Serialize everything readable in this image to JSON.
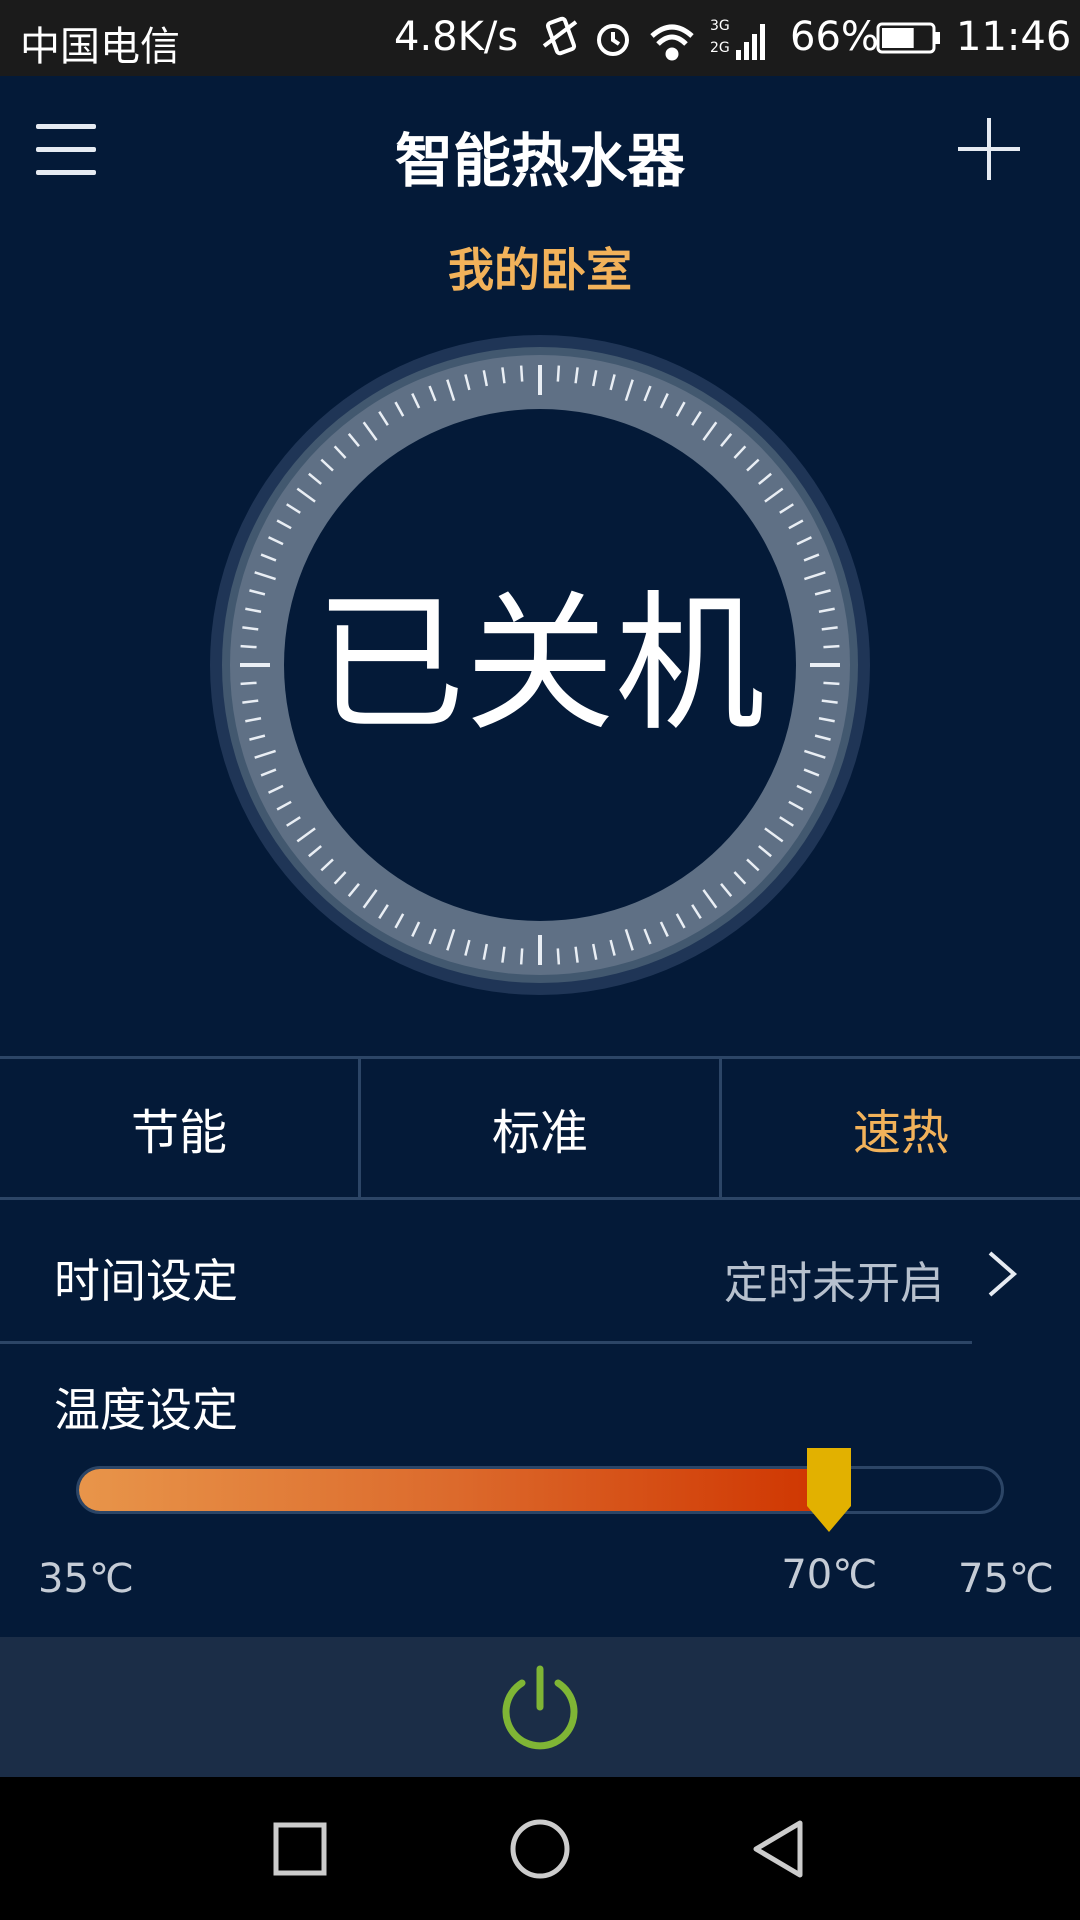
{
  "status_bar": {
    "carrier": "中国电信",
    "network_speed": "4.8K/s",
    "network_type_top": "3G",
    "network_type_bottom": "2G",
    "battery": "66%",
    "battery_level": 0.66,
    "time": "11:46"
  },
  "header": {
    "title": "智能热水器",
    "room": "我的卧室"
  },
  "dial": {
    "status": "已关机"
  },
  "modes": [
    {
      "label": "节能",
      "active": false
    },
    {
      "label": "标准",
      "active": false
    },
    {
      "label": "速热",
      "active": true
    }
  ],
  "time_setting": {
    "label": "时间设定",
    "value": "定时未开启"
  },
  "temperature": {
    "label": "温度设定",
    "min_label": "35℃",
    "current_label": "70℃",
    "max_label": "75℃",
    "min": 35,
    "max": 75,
    "current": 70
  },
  "colors": {
    "background": "#041a38",
    "accent": "#f2b25a",
    "power": "#7fb535",
    "thumb": "#e2b100"
  },
  "icons": {
    "menu": "menu-icon",
    "add": "plus-icon",
    "chevron": "chevron-right-icon",
    "power": "power-icon",
    "nav_recent": "square-icon",
    "nav_home": "circle-icon",
    "nav_back": "triangle-back-icon"
  }
}
